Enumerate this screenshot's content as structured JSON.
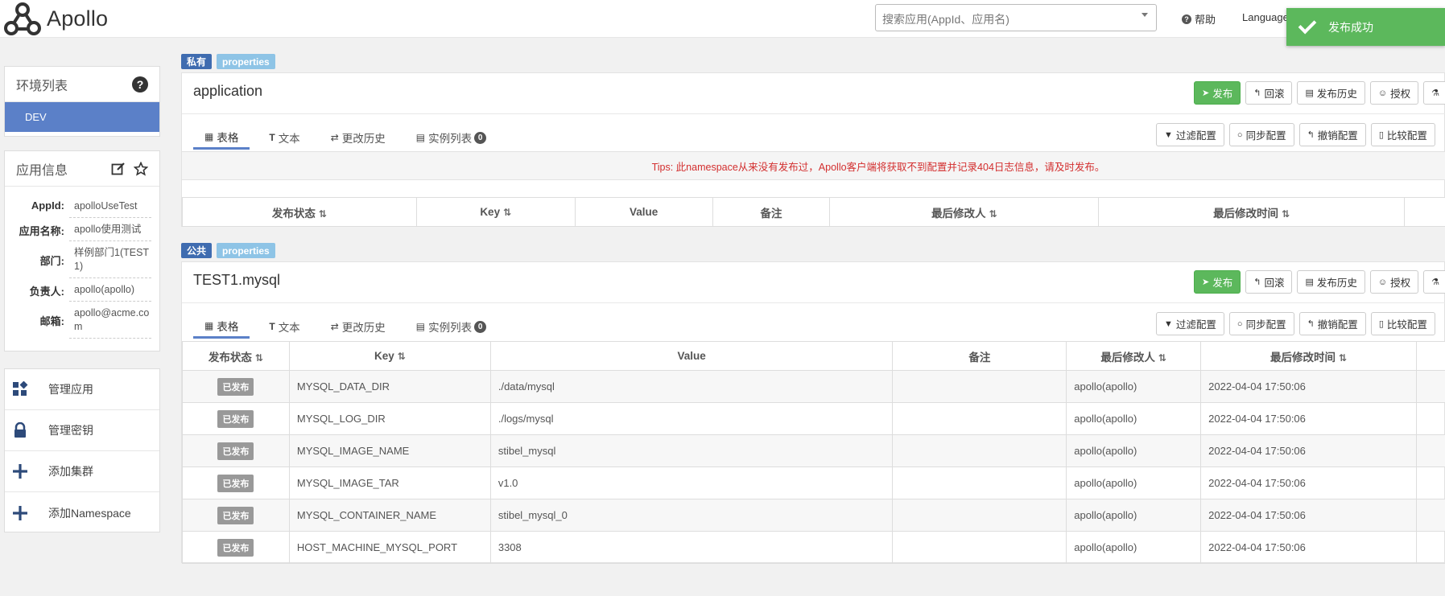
{
  "header": {
    "app_name": "Apollo",
    "search_placeholder": "搜索应用(AppId、应用名)",
    "help_label": "帮助",
    "language_label": "Language",
    "toast": "发布成功"
  },
  "env_panel": {
    "title": "环境列表",
    "envs": [
      "DEV"
    ]
  },
  "app_info": {
    "title": "应用信息",
    "fields": [
      {
        "label": "AppId:",
        "value": "apolloUseTest"
      },
      {
        "label": "应用名称:",
        "value": "apollo使用测试"
      },
      {
        "label": "部门:",
        "value": "样例部门1(TEST1)"
      },
      {
        "label": "负责人:",
        "value": "apollo(apollo)"
      },
      {
        "label": "邮箱:",
        "value": "apollo@acme.com"
      }
    ]
  },
  "menu": [
    {
      "label": "管理应用",
      "icon": "grid-icon"
    },
    {
      "label": "管理密钥",
      "icon": "lock-icon"
    },
    {
      "label": "添加集群",
      "icon": "plus-icon"
    },
    {
      "label": "添加Namespace",
      "icon": "plus-icon"
    }
  ],
  "namespaces": [
    {
      "scope": "私有",
      "format": "properties",
      "name": "application",
      "tips": "Tips: 此namespace从来没有发布过，Apollo客户端将获取不到配置并记录404日志信息，请及时发布。"
    },
    {
      "scope": "公共",
      "format": "properties",
      "name": "TEST1.mysql"
    }
  ],
  "actions": {
    "publish": "发布",
    "rollback": "回滚",
    "history": "发布历史",
    "grant": "授权"
  },
  "tools": {
    "filter": "过滤配置",
    "sync": "同步配置",
    "revoke": "撤销配置",
    "diff": "比较配置"
  },
  "tabs": {
    "table": "表格",
    "text": "文本",
    "history": "更改历史",
    "instances": "实例列表",
    "instances_count": "0"
  },
  "columns": {
    "status": "发布状态",
    "key": "Key",
    "value": "Value",
    "comment": "备注",
    "modifier": "最后修改人",
    "time": "最后修改时间"
  },
  "published_label": "已发布",
  "rows": [
    {
      "key": "MYSQL_DATA_DIR",
      "value": "./data/mysql",
      "comment": "",
      "modifier": "apollo(apollo)",
      "time": "2022-04-04 17:50:06"
    },
    {
      "key": "MYSQL_LOG_DIR",
      "value": "./logs/mysql",
      "comment": "",
      "modifier": "apollo(apollo)",
      "time": "2022-04-04 17:50:06"
    },
    {
      "key": "MYSQL_IMAGE_NAME",
      "value": "stibel_mysql",
      "comment": "",
      "modifier": "apollo(apollo)",
      "time": "2022-04-04 17:50:06"
    },
    {
      "key": "MYSQL_IMAGE_TAR",
      "value": "v1.0",
      "comment": "",
      "modifier": "apollo(apollo)",
      "time": "2022-04-04 17:50:06"
    },
    {
      "key": "MYSQL_CONTAINER_NAME",
      "value": "stibel_mysql_0",
      "comment": "",
      "modifier": "apollo(apollo)",
      "time": "2022-04-04 17:50:06"
    },
    {
      "key": "HOST_MACHINE_MYSQL_PORT",
      "value": "3308",
      "comment": "",
      "modifier": "apollo(apollo)",
      "time": "2022-04-04 17:50:06"
    }
  ]
}
